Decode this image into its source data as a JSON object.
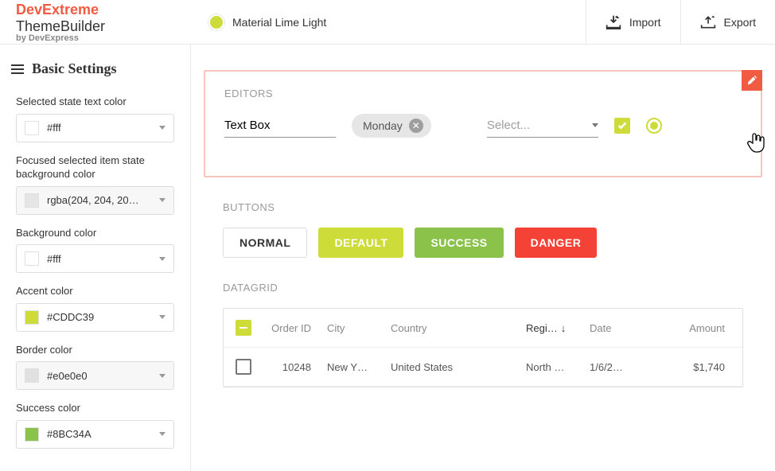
{
  "brand": {
    "accent_word": "DevExtreme",
    "rest": " ThemeBuilder",
    "subtitle": "by DevExpress"
  },
  "topbar": {
    "theme_name": "Material Lime Light",
    "import_label": "Import",
    "export_label": "Export"
  },
  "sidebar": {
    "title": "Basic Settings",
    "fields": [
      {
        "label": "Selected state text color",
        "value": "#fff",
        "swatch": "#ffffff",
        "disabled": false
      },
      {
        "label": "Focused selected item state background color",
        "value": "rgba(204, 204, 20…",
        "swatch": "#e5e5e5",
        "disabled": true
      },
      {
        "label": "Background color",
        "value": "#fff",
        "swatch": "#ffffff",
        "disabled": false
      },
      {
        "label": "Accent color",
        "value": "#CDDC39",
        "swatch": "#cddc39",
        "disabled": false
      },
      {
        "label": "Border color",
        "value": "#e0e0e0",
        "swatch": "#e0e0e0",
        "disabled": true
      },
      {
        "label": "Success color",
        "value": "#8BC34A",
        "swatch": "#8bc34a",
        "disabled": false
      }
    ]
  },
  "sections": {
    "editors": {
      "title": "EDITORS",
      "textbox_value": "Text Box",
      "chip_label": "Monday",
      "select_placeholder": "Select..."
    },
    "buttons": {
      "title": "BUTTONS",
      "normal": "NORMAL",
      "default": "DEFAULT",
      "success": "SUCCESS",
      "danger": "DANGER"
    },
    "datagrid": {
      "title": "DATAGRID",
      "columns": {
        "order_id": "Order ID",
        "city": "City",
        "country": "Country",
        "region": "Regi…",
        "date": "Date",
        "amount": "Amount"
      },
      "sort_indicator": "↓",
      "rows": [
        {
          "order_id": "10248",
          "city": "New Y…",
          "country": "United States",
          "region": "North …",
          "date": "1/6/2…",
          "amount": "$1,740"
        }
      ]
    }
  }
}
